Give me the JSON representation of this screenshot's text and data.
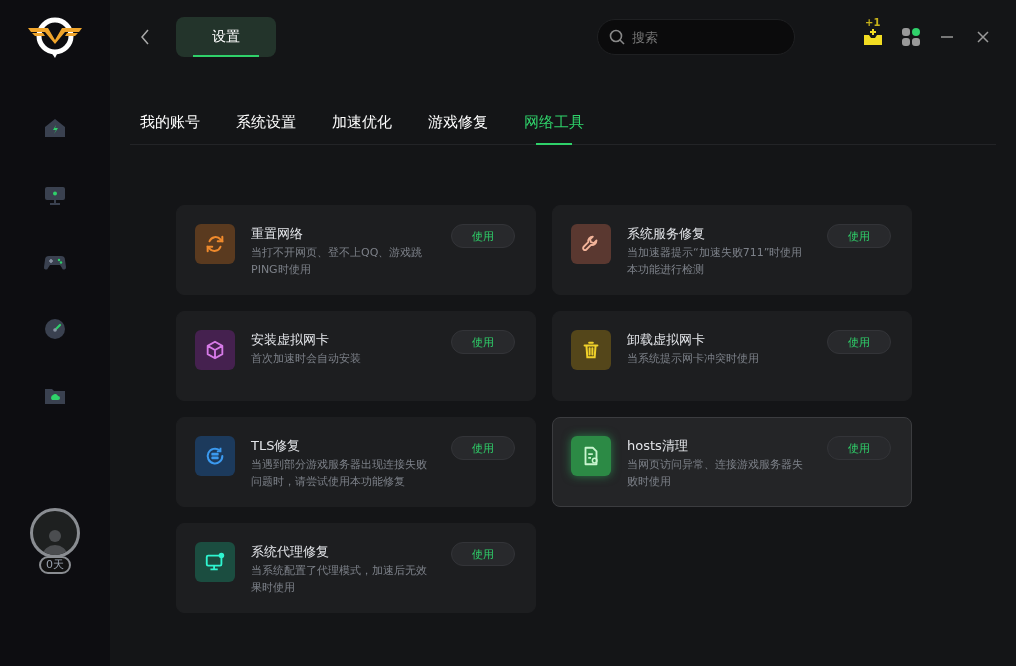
{
  "header": {
    "page_tab": "设置",
    "search": {
      "placeholder": "搜索"
    },
    "gift_badge": "+1"
  },
  "sidebar": {
    "items": [
      {
        "kind": "home"
      },
      {
        "kind": "monitor"
      },
      {
        "kind": "gamepad"
      },
      {
        "kind": "speed"
      },
      {
        "kind": "folder"
      }
    ],
    "vip_days": "0天"
  },
  "tabs": [
    {
      "label": "我的账号",
      "selected": false
    },
    {
      "label": "系统设置",
      "selected": false
    },
    {
      "label": "加速优化",
      "selected": false
    },
    {
      "label": "游戏修复",
      "selected": false
    },
    {
      "label": "网络工具",
      "selected": true
    }
  ],
  "tools": [
    {
      "kind": "refresh",
      "color": "#5a3a1f",
      "title": "重置网络",
      "description": "当打不开网页、登不上QQ、游戏跳PING时使用",
      "button": "使用",
      "highlighted": false
    },
    {
      "kind": "wrench",
      "color": "#5a3830",
      "title": "系统服务修复",
      "description": "当加速器提示“加速失败711”时使用本功能进行检测",
      "button": "使用",
      "highlighted": false
    },
    {
      "kind": "cube",
      "color": "#45214f",
      "title": "安装虚拟网卡",
      "description": "首次加速时会自动安装",
      "button": "使用",
      "highlighted": false
    },
    {
      "kind": "trash",
      "color": "#54461a",
      "title": "卸载虚拟网卡",
      "description": "当系统提示网卡冲突时使用",
      "button": "使用",
      "highlighted": false
    },
    {
      "kind": "server",
      "color": "#1c3a5c",
      "title": "TLS修复",
      "description": "当遇到部分游戏服务器出现连接失败问题时，请尝试使用本功能修复",
      "button": "使用",
      "highlighted": false
    },
    {
      "kind": "file",
      "color": "#2c8a45",
      "title": "hosts清理",
      "description": "当网页访问异常、连接游戏服务器失败时使用",
      "button": "使用",
      "highlighted": true
    },
    {
      "kind": "screen",
      "color": "#1b4d40",
      "title": "系统代理修复",
      "description": "当系统配置了代理模式，加速后无效果时使用",
      "button": "使用",
      "highlighted": false
    }
  ]
}
